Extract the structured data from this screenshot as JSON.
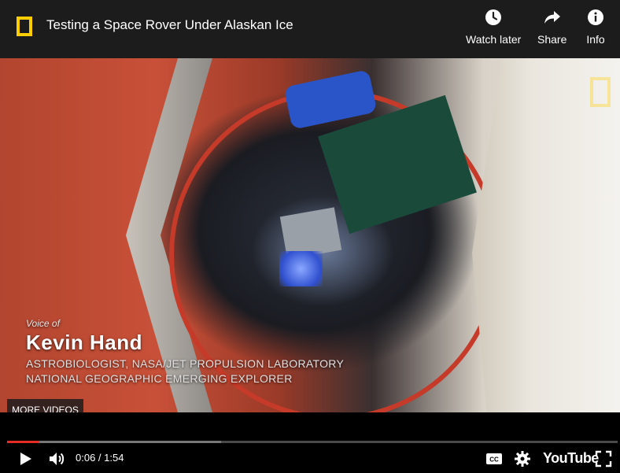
{
  "header": {
    "brand_logo": "national-geographic-yellow-border",
    "title": "Testing a Space Rover Under Alaskan Ice",
    "buttons": [
      {
        "label": "Watch later",
        "icon": "clock-icon"
      },
      {
        "label": "Share",
        "icon": "share-arrow-icon"
      },
      {
        "label": "Info",
        "icon": "info-icon"
      }
    ]
  },
  "video": {
    "lower_third": {
      "voice_of": "Voice of",
      "name": "Kevin Hand",
      "line1": "ASTROBIOLOGIST, NASA/JET PROPULSION LABORATORY",
      "line2": "NATIONAL GEOGRAPHIC EMERGING EXPLORER"
    },
    "more_videos_label": "MORE VIDEOS"
  },
  "player": {
    "current_time": "0:06",
    "separator": " / ",
    "duration": "1:54",
    "time_text": "0:06 / 1:54",
    "played_fraction": 0.053,
    "buffered_fraction": 0.35,
    "brand_text": "YouTube",
    "icons": [
      "play-icon",
      "volume-icon",
      "captions-icon",
      "settings-gear-icon",
      "youtube-logo",
      "fullscreen-icon"
    ]
  },
  "colors": {
    "accent": "#e52d27",
    "brand_yellow": "#ffce00",
    "topbar_bg": "#1c1c1c"
  }
}
